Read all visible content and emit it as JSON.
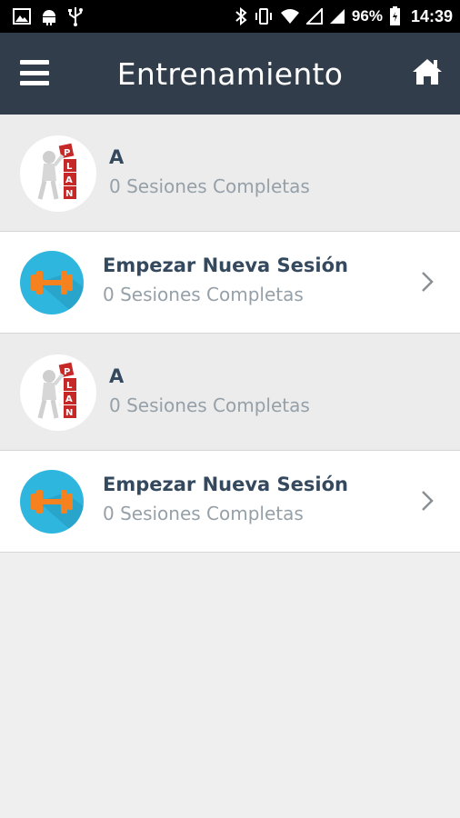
{
  "status_bar": {
    "battery": "96%",
    "time": "14:39"
  },
  "app_bar": {
    "title": "Entrenamiento",
    "menu_icon": "menu-icon",
    "home_icon": "home-icon"
  },
  "list": [
    {
      "kind": "plan",
      "title": "A",
      "subtitle": "0 Sesiones Completas",
      "icon": "plan-figure-icon"
    },
    {
      "kind": "session",
      "title": "Empezar Nueva Sesión",
      "subtitle": "0 Sesiones Completas",
      "icon": "dumbbell-icon"
    },
    {
      "kind": "plan",
      "title": "A",
      "subtitle": "0 Sesiones Completas",
      "icon": "plan-figure-icon"
    },
    {
      "kind": "session",
      "title": "Empezar Nueva Sesión",
      "subtitle": "0 Sesiones Completas",
      "icon": "dumbbell-icon"
    }
  ],
  "colors": {
    "app_bar": "#313d4a",
    "title_text": "#34495e",
    "subtitle_text": "#95a0a8",
    "session_avatar": "#2fb6de",
    "dumbbell": "#f5821f",
    "plan_cube": "#c62828"
  }
}
